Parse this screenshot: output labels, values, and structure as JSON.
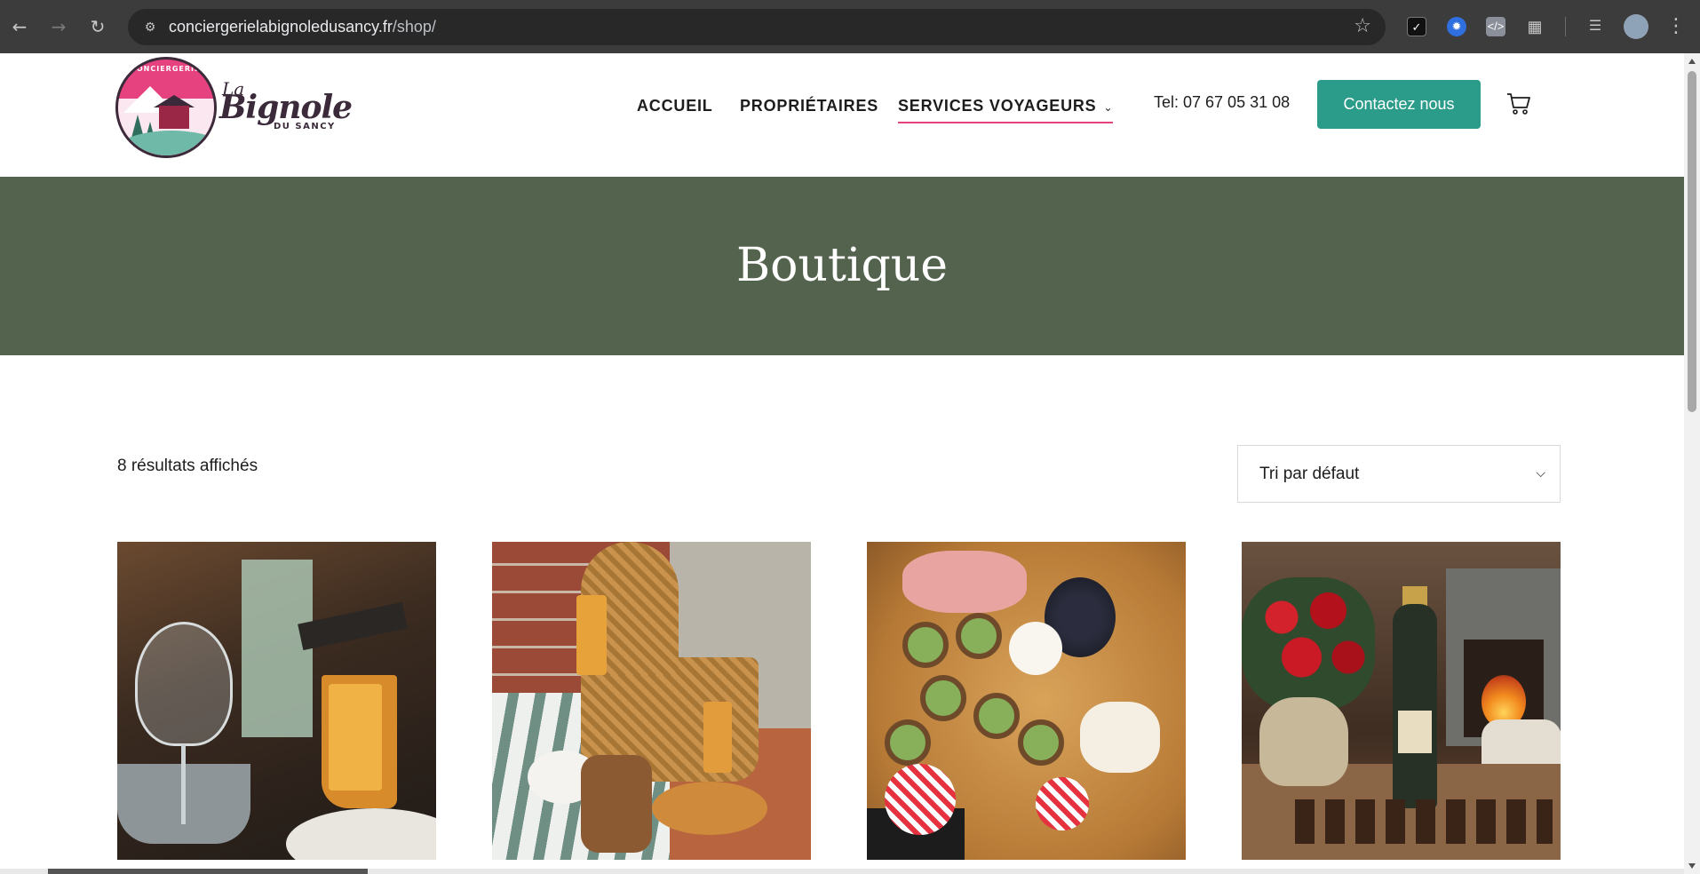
{
  "browser": {
    "url_domain": "conciergerielabignoledusancy.fr",
    "url_path": "/shop/",
    "icons": [
      "back-icon",
      "forward-icon",
      "reload-icon",
      "site-settings-icon",
      "bookmark-star-icon",
      "extensions-icon",
      "media-icon",
      "profile-icon",
      "menu-icon"
    ]
  },
  "logo": {
    "ring_text": "CONCIERGERIE",
    "la": "La",
    "name": "Bignole",
    "sub": "DU SANCY"
  },
  "nav": {
    "items": [
      {
        "label": "ACCUEIL"
      },
      {
        "label": "PROPRIÉTAIRES"
      },
      {
        "label": "SERVICES VOYAGEURS",
        "has_dropdown": true,
        "active": true
      }
    ],
    "tel": "Tel: 07 67 05 31 08",
    "contact_label": "Contactez nous",
    "accent_color": "#2b9c89",
    "active_underline_color": "#e6427f"
  },
  "banner": {
    "title": "Boutique",
    "background": "#53634d"
  },
  "shop": {
    "results_text": "8 résultats affichés",
    "sort_selected": "Tri par défaut",
    "products": [
      {
        "image": "raclette-cheese-photo"
      },
      {
        "image": "breakfast-basket-photo"
      },
      {
        "image": "charcuterie-board-photo"
      },
      {
        "image": "champagne-roses-chocolates-photo"
      }
    ]
  }
}
